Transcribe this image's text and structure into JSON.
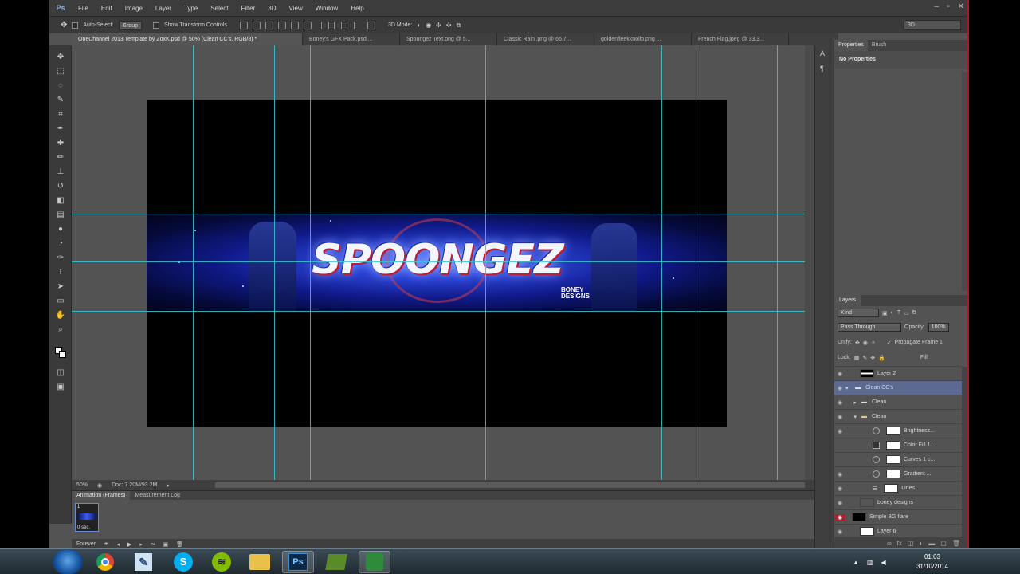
{
  "menu": {
    "app_icon": "Ps",
    "items": [
      "File",
      "Edit",
      "Image",
      "Layer",
      "Type",
      "Select",
      "Filter",
      "3D",
      "View",
      "Window",
      "Help"
    ]
  },
  "options": {
    "auto_select_label": "Auto-Select:",
    "auto_select_value": "Group",
    "show_transform_label": "Show Transform Controls",
    "mode_label": "3D Mode:",
    "workspace": "3D"
  },
  "tabs": [
    "OneChannel 2013 Template by ZoxK.psd @ 50% (Clean CC's, RGB/8) *",
    "Boney's GFX Pack.psd ...",
    "Spoongez Text.png @ 5...",
    "Classic Rainl.png @ 66.7...",
    "goldenfleekknollo.png ...",
    "French Flag.jpeg @ 33.3..."
  ],
  "canvas": {
    "banner_title": "SPOONGEZ",
    "banner_sub_1": "BONEY",
    "banner_sub_2": "DESIGNS"
  },
  "status": {
    "zoom": "50%",
    "doc": "Doc: 7.20M/93.2M"
  },
  "anim": {
    "tab_active": "Animation (Frames)",
    "tab_other": "Measurement Log",
    "frame_num": "1",
    "frame_time": "0 sec.",
    "loop": "Forever"
  },
  "properties": {
    "tab_active": "Properties",
    "tab_other": "Brush",
    "heading": "No Properties"
  },
  "layers": {
    "tab": "Layers",
    "kind": "Kind",
    "blend": "Pass Through",
    "opacity_label": "Opacity:",
    "opacity": "100%",
    "unify": "Unify:",
    "propagate": "Propagate Frame 1",
    "lock": "Lock:",
    "fill_label": "Fill:",
    "items": [
      {
        "name": "Layer 2"
      },
      {
        "name": "Clean CC's"
      },
      {
        "name": "Clean"
      },
      {
        "name": "Clean"
      },
      {
        "name": "Brightness..."
      },
      {
        "name": "Color Fill 1..."
      },
      {
        "name": "Curves 1 c..."
      },
      {
        "name": "Gradient ..."
      },
      {
        "name": "Lines"
      },
      {
        "name": "boney designs"
      },
      {
        "name": "Simple BG flare"
      },
      {
        "name": "Layer 6"
      }
    ]
  },
  "taskbar": {
    "time": "01:03",
    "date": "31/10/2014",
    "apps": [
      "Chrome",
      "Paint",
      "Skype",
      "Spotify",
      "Explorer",
      "Ps",
      "Nvidia",
      "Camtasia"
    ]
  }
}
